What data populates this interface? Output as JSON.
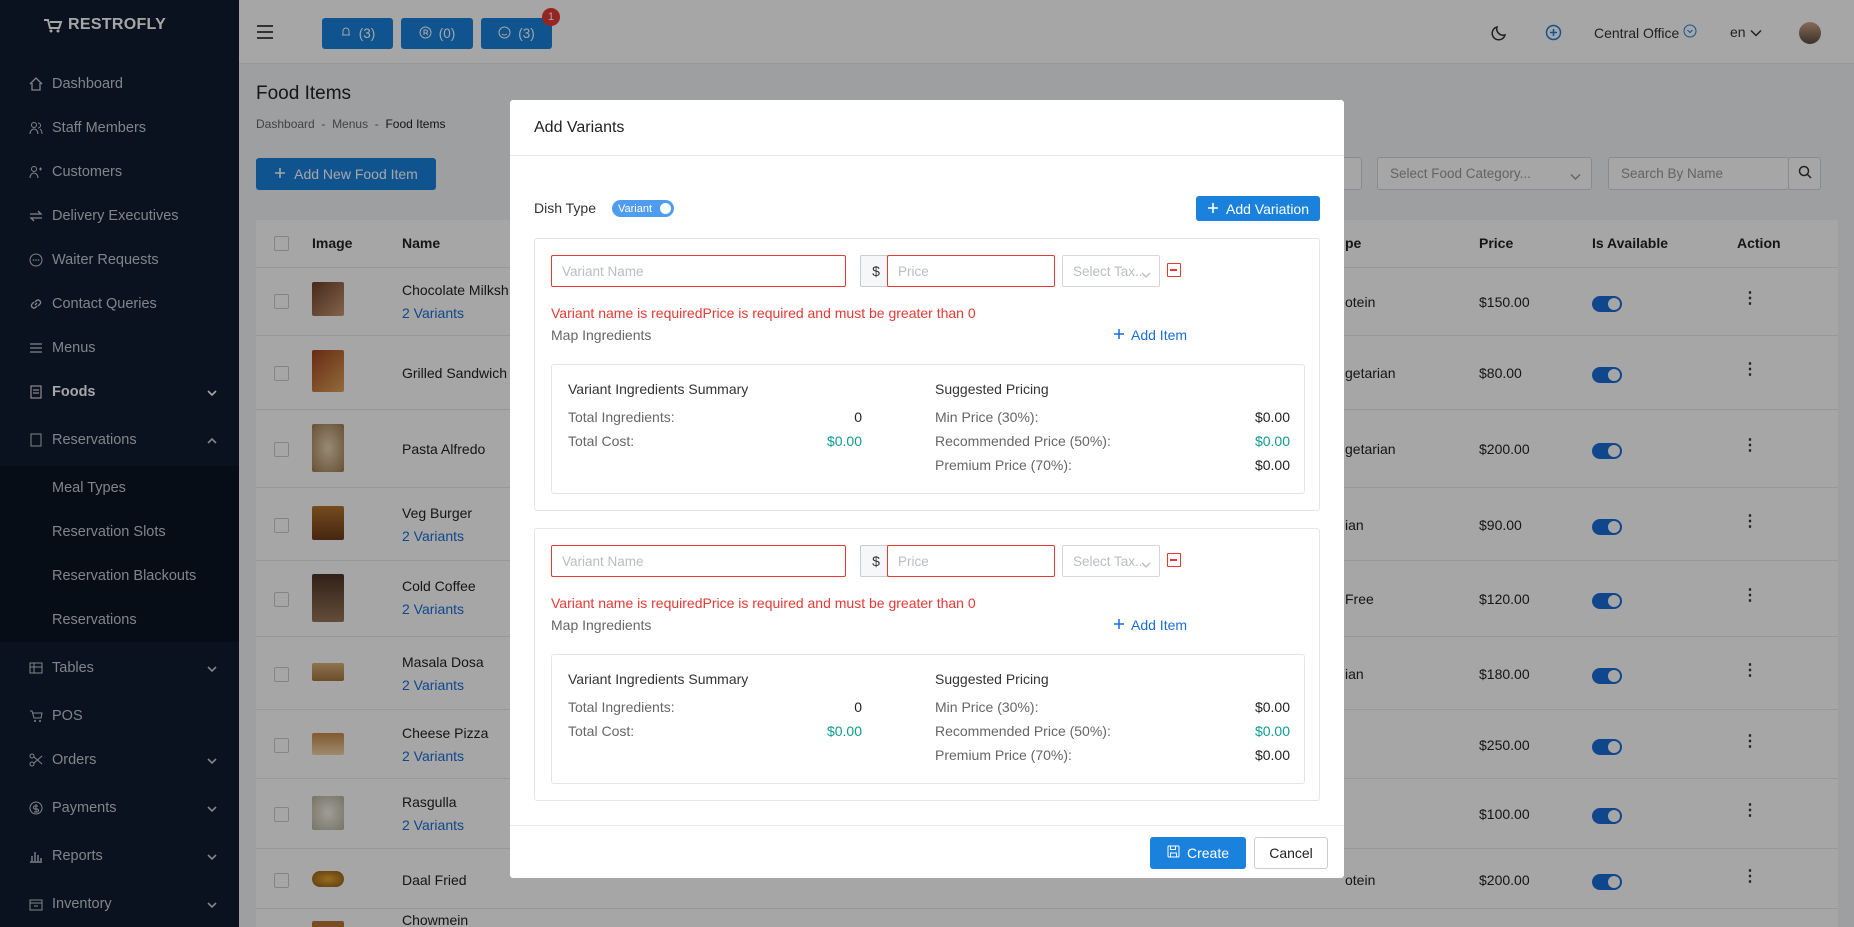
{
  "app": {
    "logo": "RESTROFLY"
  },
  "sidebar": {
    "items": [
      {
        "label": "Dashboard",
        "icon": "home-icon"
      },
      {
        "label": "Staff Members",
        "icon": "users-icon"
      },
      {
        "label": "Customers",
        "icon": "user-group-icon"
      },
      {
        "label": "Delivery Executives",
        "icon": "arrows-icon"
      },
      {
        "label": "Waiter Requests",
        "icon": "chat-icon"
      },
      {
        "label": "Contact Queries",
        "icon": "link-icon"
      },
      {
        "label": "Menus",
        "icon": "list-icon"
      },
      {
        "label": "Foods",
        "icon": "document-icon"
      },
      {
        "label": "Reservations",
        "icon": "calendar-icon"
      },
      {
        "label": "Tables",
        "icon": "table-icon"
      },
      {
        "label": "POS",
        "icon": "cart-icon"
      },
      {
        "label": "Orders",
        "icon": "scissors-icon"
      },
      {
        "label": "Payments",
        "icon": "coin-icon"
      },
      {
        "label": "Reports",
        "icon": "bar-chart-icon"
      },
      {
        "label": "Inventory",
        "icon": "box-icon"
      }
    ],
    "reservations_sub": [
      "Meal Types",
      "Reservation Slots",
      "Reservation Blackouts",
      "Reservations"
    ]
  },
  "header": {
    "pill1": "(3)",
    "pill2": "(0)",
    "pill3": "(3)",
    "notif_count": "1",
    "branch": "Central Office",
    "lang": "en"
  },
  "page": {
    "title": "Food Items",
    "breadcrumb": [
      "Dashboard",
      "Menus",
      "Food Items"
    ],
    "breadcrumb_sep": "-",
    "add_button": "Add New Food Item",
    "category_placeholder": "Select Food Category...",
    "search_placeholder": "Search By Name"
  },
  "table": {
    "headers": {
      "image": "Image",
      "name": "Name",
      "type": "pe",
      "price": "Price",
      "available": "Is Available",
      "action": "Action"
    },
    "rows": [
      {
        "name": "Chocolate Milksh",
        "variants": "2 Variants",
        "type": "otein",
        "price": "$150.00"
      },
      {
        "name": "Grilled Sandwich",
        "variants": "",
        "type": "getarian",
        "price": "$80.00"
      },
      {
        "name": "Pasta Alfredo",
        "variants": "",
        "type": "getarian",
        "price": "$200.00"
      },
      {
        "name": "Veg Burger",
        "variants": "2 Variants",
        "type": "ian",
        "price": "$90.00"
      },
      {
        "name": "Cold Coffee",
        "variants": "2 Variants",
        "type": "Free",
        "price": "$120.00"
      },
      {
        "name": "Masala Dosa",
        "variants": "2 Variants",
        "type": "ian",
        "price": "$180.00"
      },
      {
        "name": "Cheese Pizza",
        "variants": "2 Variants",
        "type": "",
        "price": "$250.00"
      },
      {
        "name": "Rasgulla",
        "variants": "2 Variants",
        "type": "",
        "price": "$100.00"
      },
      {
        "name": "Daal Fried",
        "variants": "",
        "type": "otein",
        "price": "$200.00"
      },
      {
        "name": "Chowmein",
        "variants": "",
        "type": "",
        "price": ""
      }
    ]
  },
  "modal": {
    "title": "Add Variants",
    "dish_type_label": "Dish Type",
    "dish_type_toggle": "Variant",
    "add_variation": "Add Variation",
    "variant_placeholder": "Variant Name",
    "currency": "$",
    "price_placeholder": "Price",
    "tax_placeholder": "Select Tax...",
    "error_text": "Variant name is requiredPrice is required and must be greater than 0",
    "map_ingredients": "Map Ingredients",
    "add_item": "Add Item",
    "summary": {
      "title": "Variant Ingredients Summary",
      "total_ingredients_label": "Total Ingredients:",
      "total_ingredients_value": "0",
      "total_cost_label": "Total Cost:",
      "total_cost_value": "$0.00"
    },
    "pricing": {
      "title": "Suggested Pricing",
      "min_label": "Min Price (30%):",
      "min_value": "$0.00",
      "rec_label": "Recommended Price (50%):",
      "rec_value": "$0.00",
      "prem_label": "Premium Price (70%):",
      "prem_value": "$0.00"
    },
    "create": "Create",
    "cancel": "Cancel"
  },
  "colors": {
    "primary": "#1a82dc",
    "sidebar": "#0f1c2e",
    "error": "#e53935",
    "teal": "#0e9b8c"
  }
}
